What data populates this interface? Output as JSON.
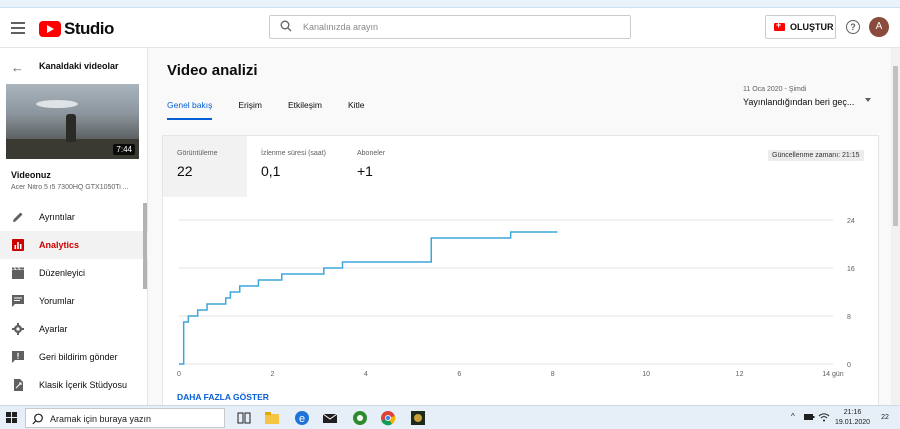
{
  "header": {
    "logo_text": "Studio",
    "search_placeholder": "Kanalınızda arayın",
    "create_label": "OLUŞTUR",
    "avatar_initial": "A"
  },
  "sidebar": {
    "back_label": "Kanaldaki videolar",
    "video_duration": "7:44",
    "video_title": "Videonuz",
    "video_subtitle": "Acer Nitro 5 i5 7300HQ GTX1050Ti ...",
    "items": [
      {
        "label": "Ayrıntılar",
        "icon": "pencil-icon"
      },
      {
        "label": "Analytics",
        "icon": "analytics-icon",
        "active": true
      },
      {
        "label": "Düzenleyici",
        "icon": "clapperboard-icon"
      },
      {
        "label": "Yorumlar",
        "icon": "comment-icon"
      },
      {
        "label": "Ayarlar",
        "icon": "gear-icon"
      },
      {
        "label": "Geri bildirim gönder",
        "icon": "feedback-icon"
      },
      {
        "label": "Klasik İçerik Stüdyosu",
        "icon": "classic-studio-icon"
      }
    ]
  },
  "main": {
    "title": "Video analizi",
    "tabs": [
      "Genel bakış",
      "Erişim",
      "Etkileşim",
      "Kitle"
    ],
    "date_range_small": "11 Oca 2020 - Şimdi",
    "date_range": "Yayınlandığından beri geç...",
    "metrics": [
      {
        "label": "Görüntüleme",
        "value": "22"
      },
      {
        "label": "İzlenme süresi (saat)",
        "value": "0,1"
      },
      {
        "label": "Aboneler",
        "value": "+1"
      }
    ],
    "updated": "Güncellenme zamanı: 21:15",
    "show_more": "DAHA FAZLA GÖSTER"
  },
  "chart_data": {
    "type": "line",
    "x_ticks": [
      "0",
      "2",
      "4",
      "6",
      "8",
      "10",
      "12",
      "14 gün"
    ],
    "y_ticks": [
      "0",
      "8",
      "16",
      "24"
    ],
    "xlim": [
      0,
      14
    ],
    "ylim": [
      0,
      24
    ],
    "series": [
      {
        "color": "#3ea6d9",
        "points": [
          [
            0,
            0
          ],
          [
            0.1,
            7
          ],
          [
            0.2,
            8
          ],
          [
            0.4,
            9
          ],
          [
            0.6,
            10
          ],
          [
            1.0,
            11
          ],
          [
            1.1,
            12
          ],
          [
            1.3,
            13
          ],
          [
            1.7,
            14
          ],
          [
            2.2,
            15
          ],
          [
            3.1,
            16
          ],
          [
            3.5,
            17
          ],
          [
            5.4,
            21
          ],
          [
            7.1,
            22
          ],
          [
            8.1,
            22
          ]
        ]
      }
    ],
    "grid": true
  },
  "taskbar": {
    "search_text": "Aramak için buraya yazın",
    "time": "21:16",
    "date": "19.01.2020",
    "notifications": "22"
  },
  "colors": {
    "accent": "#065fd4",
    "brand_red": "#ff0000",
    "active_red": "#cc0000",
    "line": "#3ea6d9"
  }
}
